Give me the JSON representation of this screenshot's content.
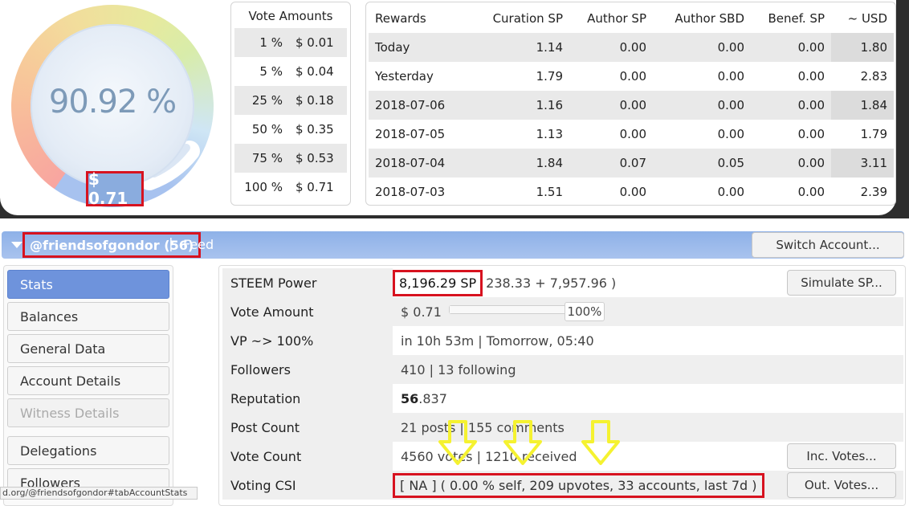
{
  "gauge": {
    "voting_power_percent": 90.92,
    "percent_text": "90.92 %",
    "vote_value": "$ 0.71"
  },
  "vote_amounts": {
    "header": "Vote Amounts",
    "rows": [
      {
        "pct": "1 %",
        "value": "$ 0.01"
      },
      {
        "pct": "5 %",
        "value": "$ 0.04"
      },
      {
        "pct": "25 %",
        "value": "$ 0.18"
      },
      {
        "pct": "50 %",
        "value": "$ 0.35"
      },
      {
        "pct": "75 %",
        "value": "$ 0.53"
      },
      {
        "pct": "100 %",
        "value": "$ 0.71"
      }
    ]
  },
  "rewards": {
    "headers": [
      "Rewards",
      "Curation SP",
      "Author SP",
      "Author SBD",
      "Benef. SP",
      "~ USD"
    ],
    "rows": [
      [
        "Today",
        "1.14",
        "0.00",
        "0.00",
        "0.00",
        "1.80"
      ],
      [
        "Yesterday",
        "1.79",
        "0.00",
        "0.00",
        "0.00",
        "2.83"
      ],
      [
        "2018-07-06",
        "1.16",
        "0.00",
        "0.00",
        "0.00",
        "1.84"
      ],
      [
        "2018-07-05",
        "1.13",
        "0.00",
        "0.00",
        "0.00",
        "1.79"
      ],
      [
        "2018-07-04",
        "1.84",
        "0.07",
        "0.05",
        "0.00",
        "3.11"
      ],
      [
        "2018-07-03",
        "1.51",
        "0.00",
        "0.00",
        "0.00",
        "2.39"
      ]
    ]
  },
  "account_bar": {
    "account": "@friendsofgondor (56)",
    "separator": "|",
    "feed": "Feed",
    "switch_label": "Switch Account..."
  },
  "nav": {
    "items": [
      "Stats",
      "Balances",
      "General Data",
      "Account Details",
      "Witness Details",
      "Delegations",
      "Followers"
    ]
  },
  "stats": {
    "steem_power_label": "STEEM Power",
    "steem_power_value": "8,196.29 SP",
    "steem_power_detail": "238.33 + 7,957.96 )",
    "simulate_label": "Simulate SP...",
    "vote_amount_label": "Vote Amount",
    "vote_amount_value": "$ 0.71",
    "vote_amount_fraction": 1.0,
    "vote_amount_pct": "100%",
    "vp_label": "VP ~> 100%",
    "vp_value": "in 10h 53m | Tomorrow, 05:40",
    "followers_label": "Followers",
    "followers_value": "410 | 13 following",
    "reputation_label": "Reputation",
    "reputation_int": "56",
    "reputation_dec": ".837",
    "post_count_label": "Post Count",
    "post_count_value": "21 posts | 155 comments",
    "vote_count_label": "Vote Count",
    "vote_count_value": "4560 votes | 1210 received",
    "inc_votes_label": "Inc. Votes...",
    "csi_label": "Voting CSI",
    "csi_value": "[ NA ] ( 0.00 % self, 209 upvotes, 33 accounts, last 7d )",
    "out_votes_label": "Out. Votes..."
  },
  "status_url": "d.org/@friendsofgondor#tabAccountStats",
  "colors": {
    "accent": "#6e93dc",
    "highlight": "#d7121f",
    "annotation_arrow": "#f5f230"
  }
}
